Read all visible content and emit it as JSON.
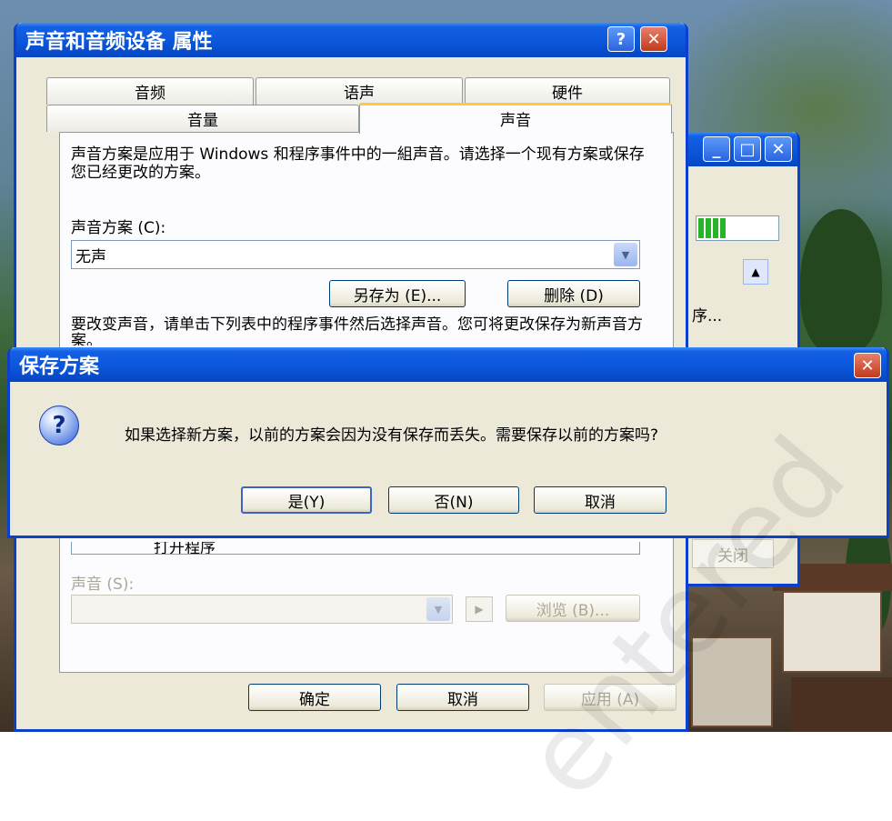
{
  "properties_window": {
    "title": "声音和音频设备 属性",
    "help_btn": "?",
    "close_btn": "✕",
    "tabs_back": [
      "音频",
      "语声",
      "硬件"
    ],
    "tabs_front": [
      "音量",
      "声音"
    ],
    "description": "声音方案是应用于 Windows 和程序事件中的一組声音。请选择一个现有方案或保存您已经更改的方案。",
    "scheme_label": "声音方案 (C):",
    "scheme_value": "无声",
    "save_as_button": "另存为 (E)...",
    "delete_button": "删除 (D)",
    "instruction": "要改变声音，请单击下列表中的程序事件然后选择声音。您可将更改保存为新声音方案。",
    "program_list_item": "打开程序",
    "sound_label": "声音 (S):",
    "browse_button": "浏览 (B)...",
    "ok_button": "确定",
    "cancel_button": "取消",
    "apply_button": "应用 (A)"
  },
  "background_window": {
    "text_fragment": "序...",
    "close_fragment": "关闭"
  },
  "save_dialog": {
    "title": "保存方案",
    "message": "如果选择新方案，以前的方案会因为没有保存而丢失。需要保存以前的方案吗?",
    "yes_button": "是(Y)",
    "no_button": "否(N)",
    "cancel_button": "取消",
    "icon": "question-icon"
  },
  "watermark": "entered"
}
